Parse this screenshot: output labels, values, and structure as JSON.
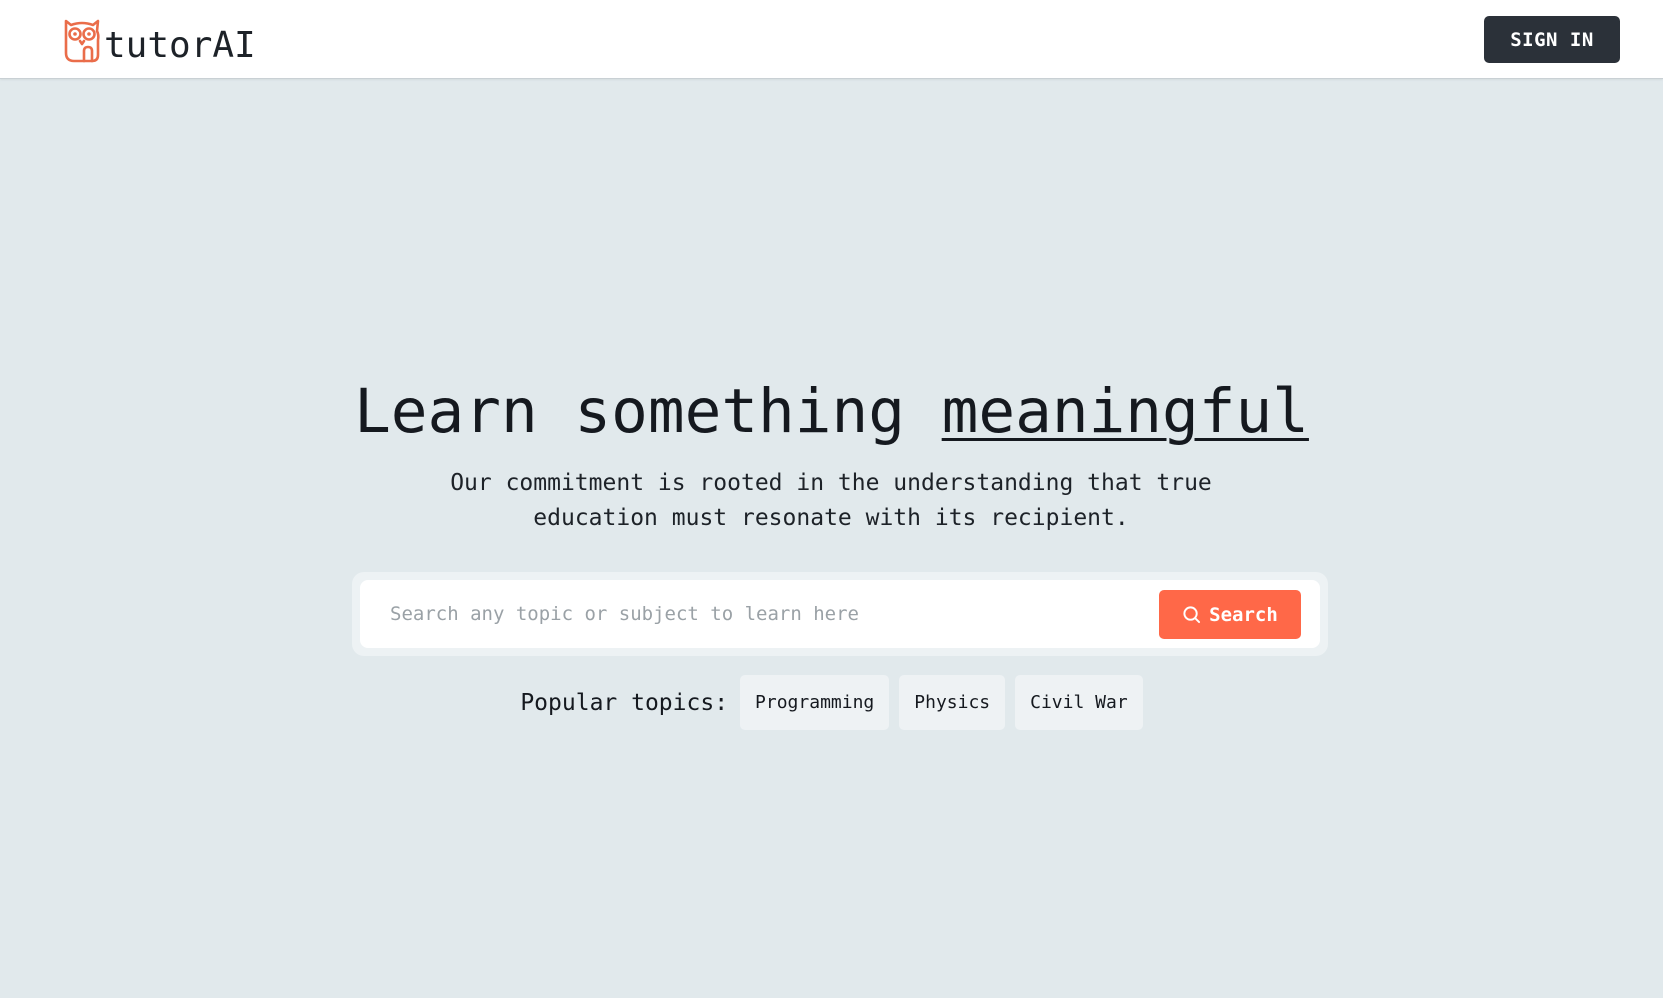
{
  "header": {
    "logo_text": "tutorAI",
    "signin_label": "SIGN IN"
  },
  "hero": {
    "title_plain": "Learn something ",
    "title_underlined": "meaningful",
    "subtitle_line1": "Our commitment is rooted in the understanding that true",
    "subtitle_line2": "education must resonate with its recipient."
  },
  "search": {
    "placeholder": "Search any topic or subject to learn here",
    "value": "",
    "button_label": "Search",
    "icon": "search-icon"
  },
  "popular": {
    "label": "Popular topics:",
    "topics": [
      "Programming",
      "Physics",
      "Civil War"
    ]
  },
  "colors": {
    "page_background": "#e1e9ec",
    "accent": "#ff6848",
    "signin_background": "#2b3139",
    "logo_icon": "#ea6d4a"
  }
}
